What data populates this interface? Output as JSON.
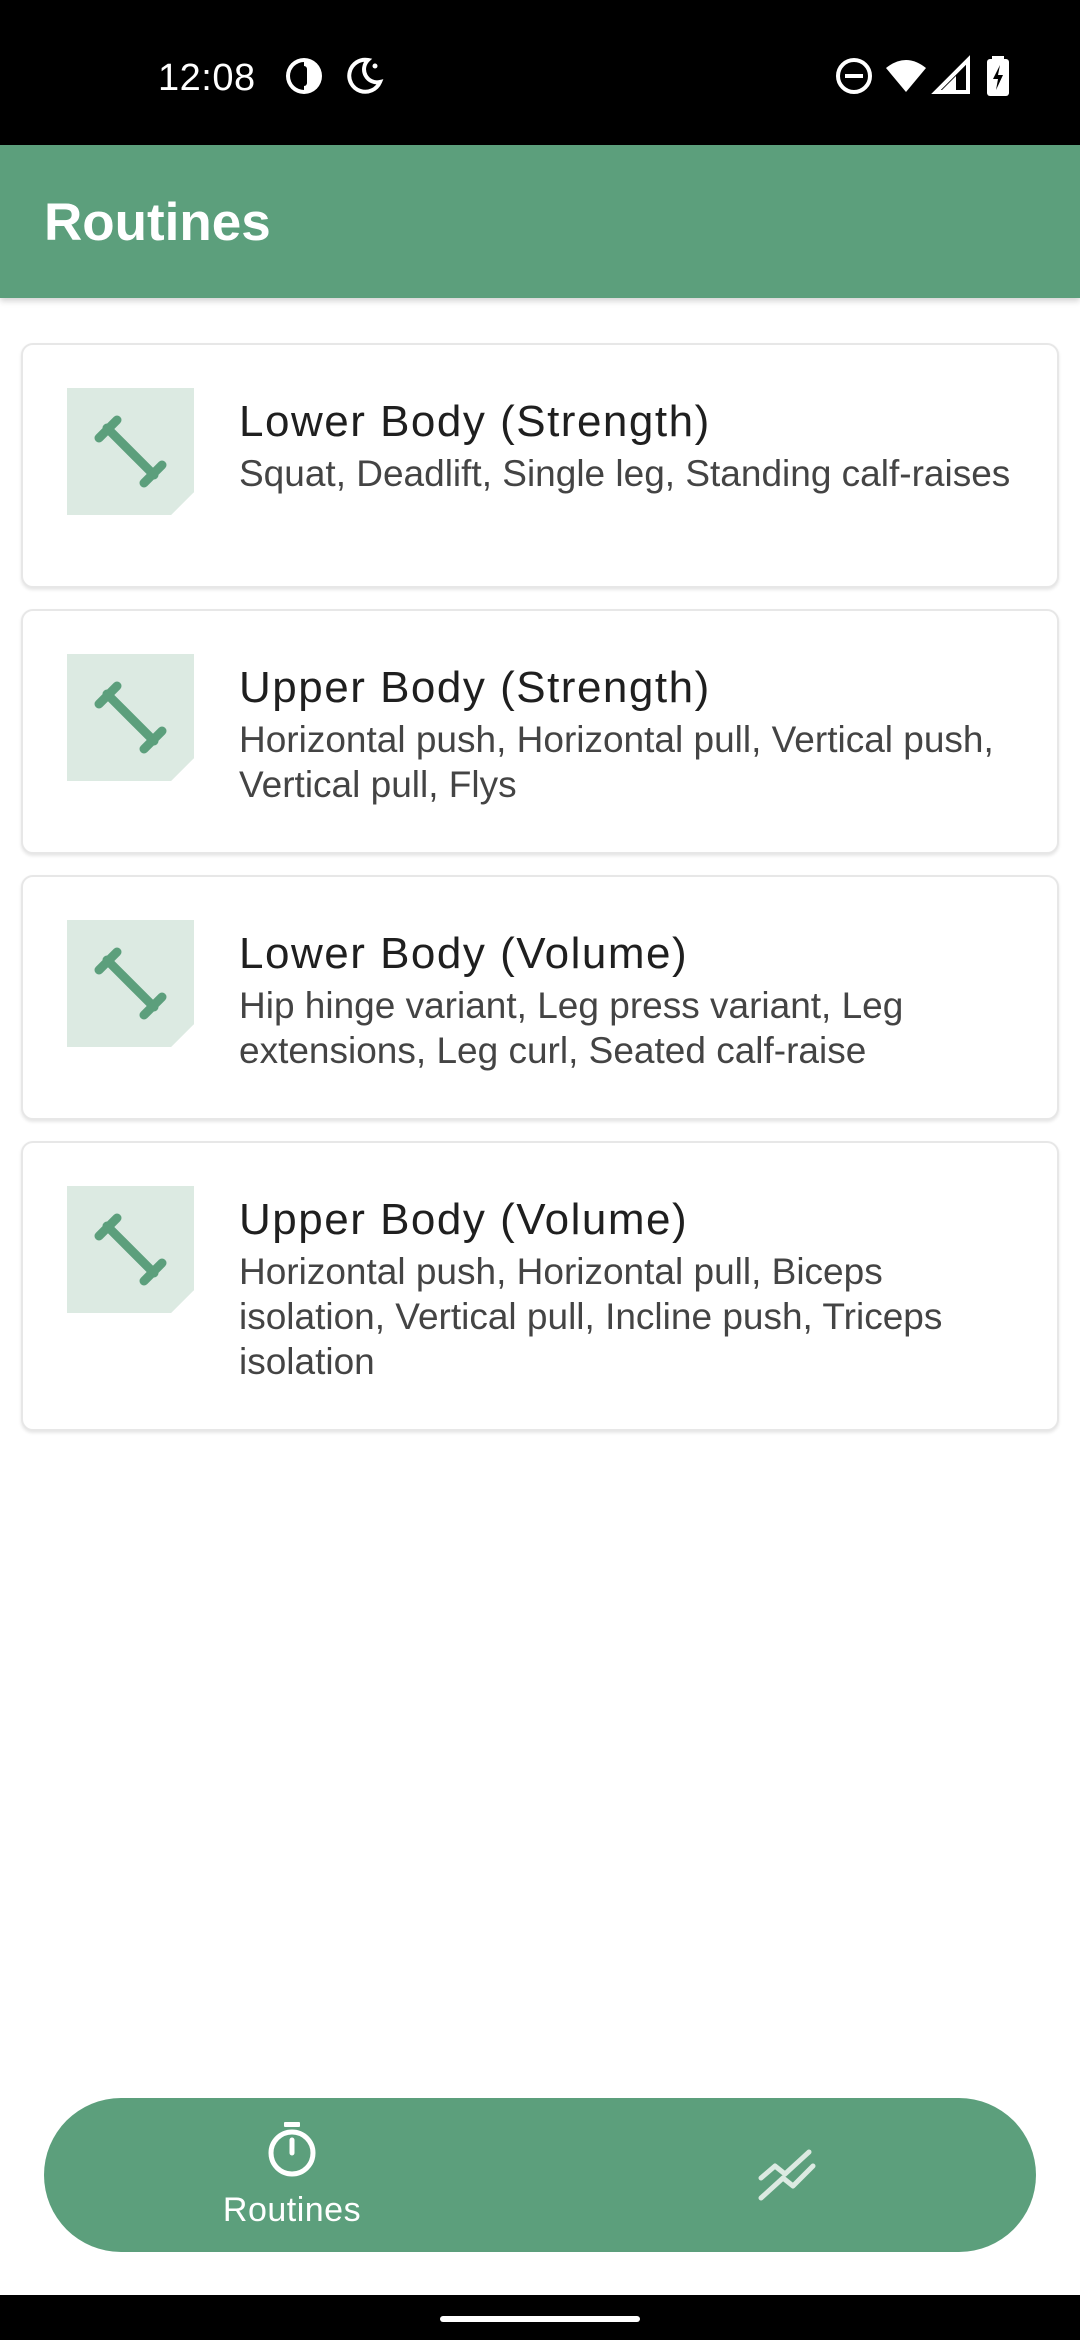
{
  "status_bar": {
    "time": "12:08",
    "icons_left": [
      "data-saver-icon",
      "do-not-disturb-moon-icon"
    ],
    "icons_right": [
      "dnd-icon",
      "wifi-icon",
      "cell-signal-icon",
      "battery-charging-icon"
    ]
  },
  "app_bar": {
    "title": "Routines",
    "color": "#5c9f7c"
  },
  "routines": [
    {
      "title": "Lower Body (Strength)",
      "exercises": "Squat, Deadlift, Single leg, Standing calf-raises",
      "icon": "dumbbell-icon"
    },
    {
      "title": "Upper Body (Strength)",
      "exercises": "Horizontal push, Horizontal pull, Vertical push, Vertical pull, Flys",
      "icon": "dumbbell-icon"
    },
    {
      "title": "Lower Body (Volume)",
      "exercises": "Hip hinge variant, Leg press variant, Leg extensions, Leg curl, Seated calf-raise",
      "icon": "dumbbell-icon"
    },
    {
      "title": "Upper Body (Volume)",
      "exercises": "Horizontal push, Horizontal pull, Biceps isolation, Vertical pull, Incline push, Triceps isolation",
      "icon": "dumbbell-icon"
    }
  ],
  "bottom_nav": {
    "routines_label": "Routines",
    "routines_icon": "stopwatch-icon",
    "stats_icon": "trend-chart-icon",
    "selected": "Routines"
  },
  "colors": {
    "accent": "#5c9f7c",
    "icon_bg": "#dceae2"
  }
}
